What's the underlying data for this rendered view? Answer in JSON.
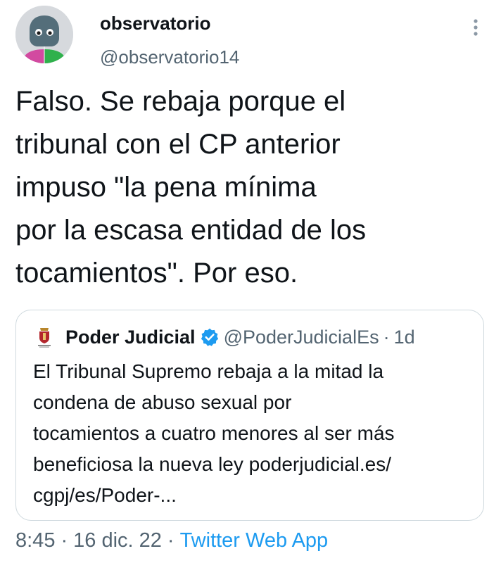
{
  "author": {
    "display_name": "observatorio",
    "handle": "@observatorio14",
    "avatar_icon": "robot-avatar-icon"
  },
  "tweet": {
    "text_lines": [
      "Falso. Se rebaja porque el",
      "tribunal con el CP anterior",
      "impuso \"la pena mínima",
      "por la escasa entidad de los",
      "tocamientos\". Por eso."
    ]
  },
  "quoted_tweet": {
    "display_name": "Poder Judicial",
    "handle": "@PoderJudicialEs",
    "separator": "·",
    "time": "1d",
    "verified_color": "#1d9bf0",
    "text_lines": [
      "El Tribunal Supremo rebaja a la mitad la",
      "condena de abuso sexual por",
      "tocamientos a cuatro menores al ser más",
      "beneficiosa la nueva ley poderjudicial.es/",
      "cgpj/es/Poder-..."
    ]
  },
  "footer": {
    "time": "8:45",
    "separator": "·",
    "date": "16 dic. 22",
    "source": "Twitter Web App"
  },
  "colors": {
    "text": "#0f1419",
    "secondary": "#536471",
    "accent": "#1d9bf0",
    "border": "#cfd9de"
  }
}
